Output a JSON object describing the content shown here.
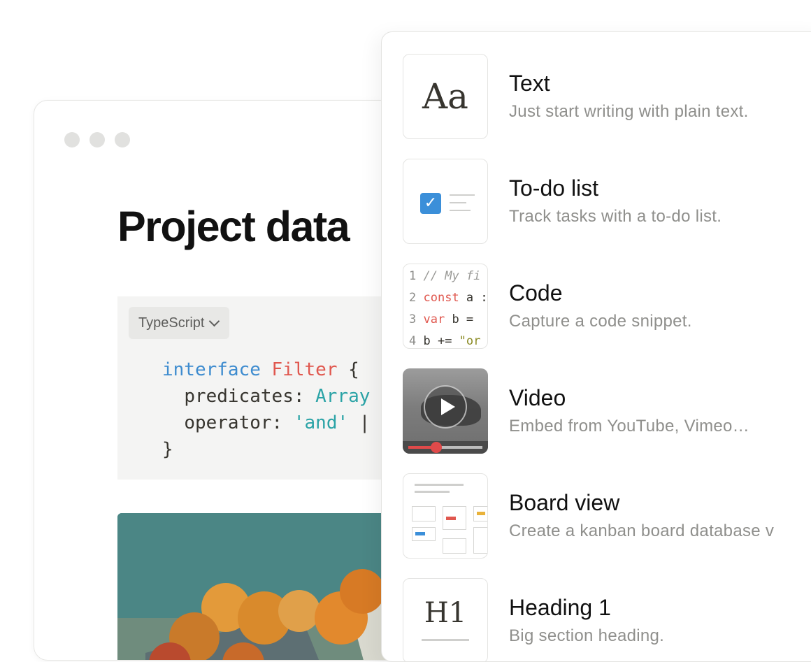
{
  "document": {
    "title": "Project data",
    "code_block": {
      "language": "TypeScript",
      "lines": {
        "l1_keyword": "interface",
        "l1_name": "Filter",
        "l1_brace": " {",
        "l2_prop": "predicates: ",
        "l2_type": "Array",
        "l3_prop": "operator: ",
        "l3_value": "'and'",
        "l3_tail": " |",
        "l4_brace": "}"
      }
    }
  },
  "menu": {
    "items": [
      {
        "title": "Text",
        "description": "Just start writing with plain text.",
        "thumb": {
          "glyph": "Aa"
        }
      },
      {
        "title": "To-do list",
        "description": "Track tasks with a to-do list.",
        "thumb": {
          "check": "✓"
        }
      },
      {
        "title": "Code",
        "description": "Capture a code snippet.",
        "thumb": {
          "lines": [
            {
              "n": "1",
              "a": "// My fi"
            },
            {
              "n": "2",
              "kw": "const",
              "b": " a :"
            },
            {
              "n": "3",
              "kw": "var",
              "b": " b ="
            },
            {
              "n": "4",
              "b": " b += ",
              "str": "\"or"
            }
          ]
        }
      },
      {
        "title": "Video",
        "description": "Embed from YouTube, Vimeo…",
        "thumb": {
          "progress": 0.38
        }
      },
      {
        "title": "Board view",
        "description": "Create a kanban board database v"
      },
      {
        "title": "Heading 1",
        "description": "Big section heading.",
        "thumb": {
          "glyph": "H1"
        }
      }
    ]
  },
  "colors": {
    "accent_blue": "#3b8fd9",
    "code_keyword_blue": "#3e8ccf",
    "code_keyword_red": "#e0574e",
    "code_type_teal": "#2aa3a6"
  },
  "icons": [
    "window-dot-icon",
    "chevron-down-icon",
    "checkbox-checked-icon",
    "play-icon"
  ]
}
